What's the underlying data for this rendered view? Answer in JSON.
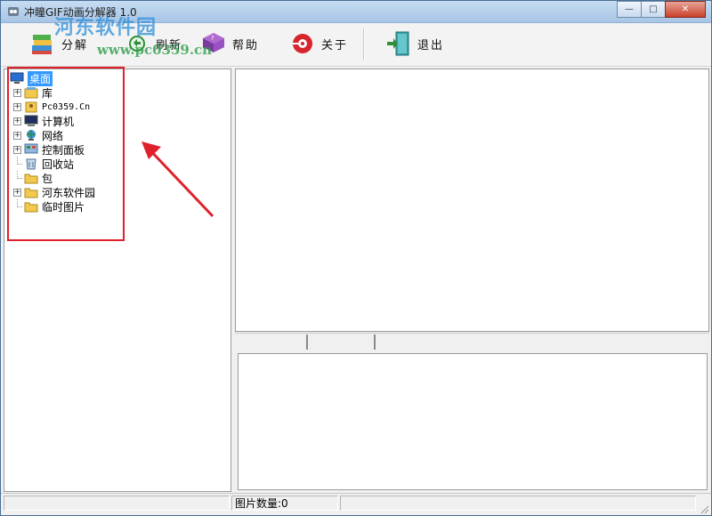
{
  "window": {
    "title": "冲瞳GIF动画分解器 1.0",
    "watermark_text": "河东软件园",
    "watermark_url": "www.pc0359.cn"
  },
  "title_buttons": {
    "minimize": "—",
    "maximize": "□",
    "close": "✕"
  },
  "toolbar": {
    "split_label": "分解",
    "refresh_label": "刷新",
    "help_label": "帮助",
    "about_label": "关于",
    "exit_label": "退出"
  },
  "tree": {
    "items": [
      {
        "label": "桌面",
        "icon": "desktop-icon",
        "expandable": false,
        "root": true
      },
      {
        "label": "库",
        "icon": "library-icon",
        "expandable": true
      },
      {
        "label": "Pc0359.Cn",
        "icon": "user-folder-icon",
        "expandable": true
      },
      {
        "label": "计算机",
        "icon": "computer-icon",
        "expandable": true
      },
      {
        "label": "网络",
        "icon": "network-icon",
        "expandable": true
      },
      {
        "label": "控制面板",
        "icon": "control-panel-icon",
        "expandable": true
      },
      {
        "label": "回收站",
        "icon": "recycle-bin-icon",
        "expandable": false
      },
      {
        "label": "包",
        "icon": "folder-icon",
        "expandable": false
      },
      {
        "label": "河东软件园",
        "icon": "folder-icon",
        "expandable": true
      },
      {
        "label": "临时图片",
        "icon": "folder-icon",
        "expandable": false
      }
    ]
  },
  "statusbar": {
    "image_count": "图片数量:0"
  },
  "colors": {
    "annotation_red": "#e0202a",
    "selection_blue": "#3399ff",
    "watermark_blue": "#2f8fd8",
    "watermark_green": "#2f9e4a"
  }
}
